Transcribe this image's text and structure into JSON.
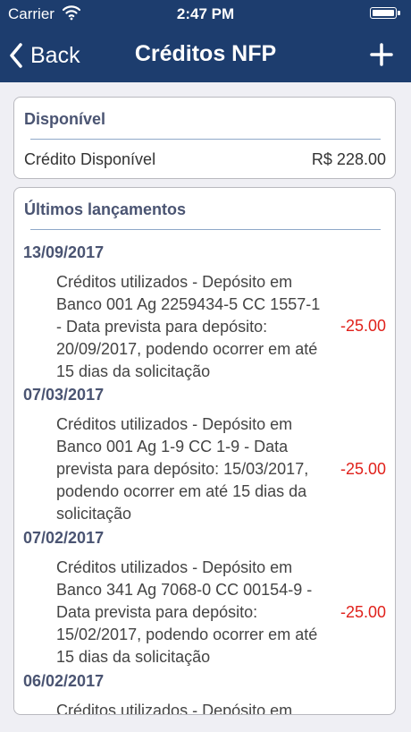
{
  "status_bar": {
    "carrier": "Carrier",
    "time": "2:47 PM"
  },
  "nav": {
    "back_label": "Back",
    "title": "Créditos NFP",
    "add_icon": "plus-icon"
  },
  "available": {
    "title": "Disponível",
    "label": "Crédito Disponível",
    "value": "R$ 228.00"
  },
  "history": {
    "title": "Últimos lançamentos",
    "groups": [
      {
        "date": "13/09/2017",
        "lines": [
          "Créditos utilizados - Depósito em",
          "Banco 001 Ag 2259434-5 CC 1557-1",
          "- Data prevista para depósito:",
          "20/09/2017, podendo ocorrer em até",
          "15 dias da solicitação"
        ],
        "amount": "-25.00"
      },
      {
        "date": "07/03/2017",
        "lines": [
          "Créditos utilizados - Depósito em",
          "Banco 001 Ag 1-9 CC 1-9 - Data",
          "prevista para depósito: 15/03/2017,",
          "podendo ocorrer em até 15 dias da",
          "solicitação"
        ],
        "amount": "-25.00"
      },
      {
        "date": "07/02/2017",
        "lines": [
          "Créditos utilizados - Depósito em",
          "Banco 341 Ag 7068-0 CC 00154-9 -",
          "Data prevista para depósito:",
          "15/02/2017, podendo ocorrer em até",
          "15 dias da solicitação"
        ],
        "amount": "-25.00"
      },
      {
        "date": "06/02/2017",
        "lines": [
          "Créditos utilizados - Depósito em"
        ],
        "amount": ""
      }
    ]
  },
  "colors": {
    "nav_bg": "#1d3d6e",
    "negative_amount": "#e0211b",
    "section_title": "#4a5472"
  }
}
